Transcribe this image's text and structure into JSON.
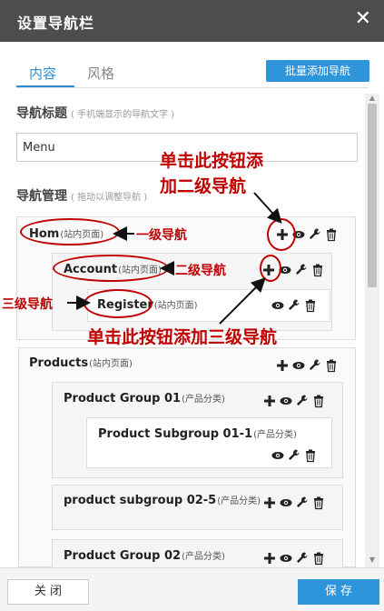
{
  "dialog": {
    "title": "设置导航栏",
    "close_glyph": "✕"
  },
  "tabs": [
    {
      "label": "内容"
    },
    {
      "label": "风格"
    }
  ],
  "batch_add_label": "批量添加导航",
  "nav_title": {
    "label": "导航标题",
    "hint": "( 手机端显示的导航文字 )",
    "value": "Menu"
  },
  "nav_manage": {
    "label": "导航管理",
    "hint": "( 拖动以调整导航 )"
  },
  "items": {
    "home": {
      "name": "Hom",
      "type": "(站内页面)"
    },
    "account": {
      "name": "Account",
      "type": "(站内页面)"
    },
    "register": {
      "name": "Register",
      "type": "(站内页面)"
    },
    "products": {
      "name": "Products",
      "type": "(站内页面)"
    },
    "pg01": {
      "name": "Product Group 01",
      "type": "(产品分类)"
    },
    "psg011": {
      "name": "Product Subgroup 01-1",
      "type": "(产品分类)"
    },
    "psg025": {
      "name": "product subgroup 02-5",
      "type": "(产品分类)"
    },
    "pg02": {
      "name": "Product Group 02",
      "type": "(产品分类)"
    }
  },
  "annotations": {
    "click_add_second_line1": "单击此按钮添",
    "click_add_second_line2": "加二级导航",
    "level1": "一级导航",
    "level2": "二级导航",
    "level3": "三级导航",
    "click_add_third": "单击此按钮添加三级导航"
  },
  "footer": {
    "close_label": "关 闭",
    "save_label": "保 存"
  },
  "colors": {
    "accent": "#2e95db",
    "annotation_red": "#c00000",
    "header_bg": "#4d4d4d"
  }
}
